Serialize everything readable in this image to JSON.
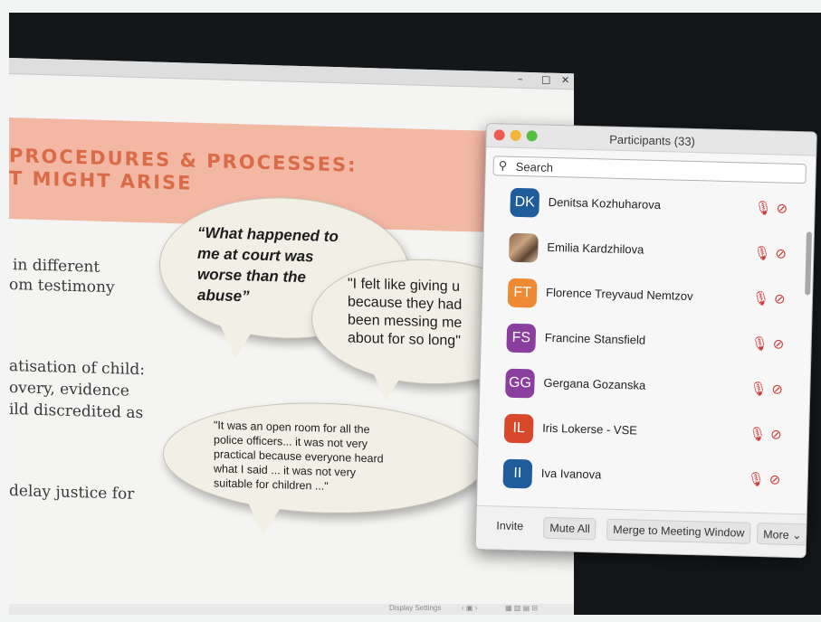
{
  "slide": {
    "window_controls": {
      "minimize": "–",
      "maximize": "□",
      "close": "✕"
    },
    "title_line1": "PROCEDURES & PROCESSES:",
    "title_line2": "T MIGHT ARISE",
    "body_lines": [
      "in different",
      "om testimony",
      "atisation of child:",
      "overy, evidence",
      "ild discredited as",
      "delay justice for"
    ],
    "quote_1": [
      "“What happened to",
      "me at court was",
      "worse than the",
      "abuse”"
    ],
    "quote_2": [
      "\"I felt like giving u",
      "because they had",
      "been messing me",
      "about for so long\""
    ],
    "quote_3": [
      "\"It was an open room for all the",
      "police officers... it was not very",
      "practical because everyone heard",
      "what I said ... it was not very",
      "suitable for children ...\""
    ],
    "statusbar": {
      "display_settings": "Display Settings"
    }
  },
  "panel": {
    "title": "Participants (33)",
    "search_placeholder": "Search",
    "participants": [
      {
        "initials": "DK",
        "name": "Denitsa Kozhuharova",
        "color": "#1f5c9c",
        "photo": false
      },
      {
        "initials": "",
        "name": "Emilia Kardzhilova",
        "color": "#8b6a52",
        "photo": true
      },
      {
        "initials": "FT",
        "name": "Florence Treyvaud Nemtzov",
        "color": "#ee8a33",
        "photo": false
      },
      {
        "initials": "FS",
        "name": "Francine Stansfield",
        "color": "#8a3e9e",
        "photo": false
      },
      {
        "initials": "GG",
        "name": "Gergana Gozanska",
        "color": "#8a3e9e",
        "photo": false
      },
      {
        "initials": "IL",
        "name": "Iris Lokerse - VSE",
        "color": "#d8482a",
        "photo": false
      },
      {
        "initials": "II",
        "name": "Iva Ivanova",
        "color": "#1f5c9c",
        "photo": false
      }
    ],
    "icons": {
      "mic": "mic-muted-icon",
      "video": "video-off-icon"
    },
    "footer": {
      "invite": "Invite",
      "mute_all": "Mute All",
      "merge": "Merge to Meeting Window",
      "more": "More ⌄"
    }
  },
  "colors": {
    "title_orange": "#d96b48",
    "band": "#f3b8a4",
    "muted_red": "#cc3b3b"
  }
}
